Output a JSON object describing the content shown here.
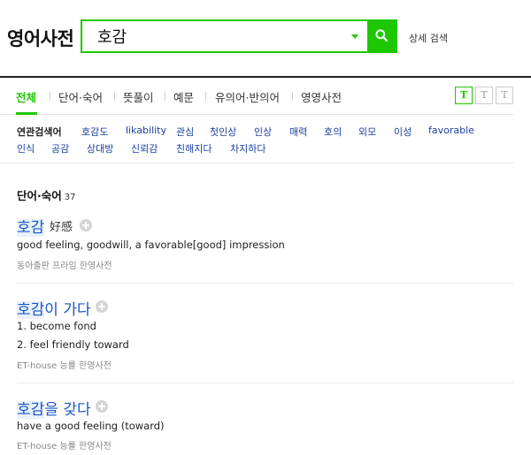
{
  "header": {
    "logo": "영어사전",
    "search_value": "호감",
    "advanced_search": "상세 검색"
  },
  "tabs": [
    {
      "label": "전체",
      "active": true
    },
    {
      "label": "단어·숙어"
    },
    {
      "label": "뜻풀이"
    },
    {
      "label": "예문"
    },
    {
      "label": "유의어·반의어"
    },
    {
      "label": "영영사전"
    }
  ],
  "font_size_buttons": [
    "T",
    "T",
    "T"
  ],
  "related": {
    "label": "연관검색어",
    "row1": [
      "호감도",
      "likability",
      "관심",
      "첫인상",
      "인상",
      "매력",
      "호의",
      "외모",
      "이성",
      "favorable"
    ],
    "row2": [
      "인식",
      "공감",
      "상대방",
      "신뢰감",
      "친해지다",
      "차지하다"
    ]
  },
  "section": {
    "title": "단어·숙어",
    "count": "37"
  },
  "entries": [
    {
      "headword_hl": "호감",
      "headword_rest": "",
      "hanja": "好感",
      "meanings": [
        "good feeling, goodwill, a favorable[good] impression"
      ],
      "source": "동아출판 프라임 한영사전"
    },
    {
      "headword_hl": "호감",
      "headword_rest": "이 가다",
      "meanings": [
        "1. become fond",
        "2. feel friendly toward"
      ],
      "source": "ET-house 능률 한영사전"
    },
    {
      "headword_hl": "호감",
      "headword_rest": "을 갖다",
      "meanings": [
        "have a good feeling (toward)"
      ],
      "source": "ET-house 능률 한영사전"
    }
  ],
  "colors": {
    "accent": "#1ec800",
    "link": "#1a56c9",
    "related_link": "#1a3fa3"
  }
}
